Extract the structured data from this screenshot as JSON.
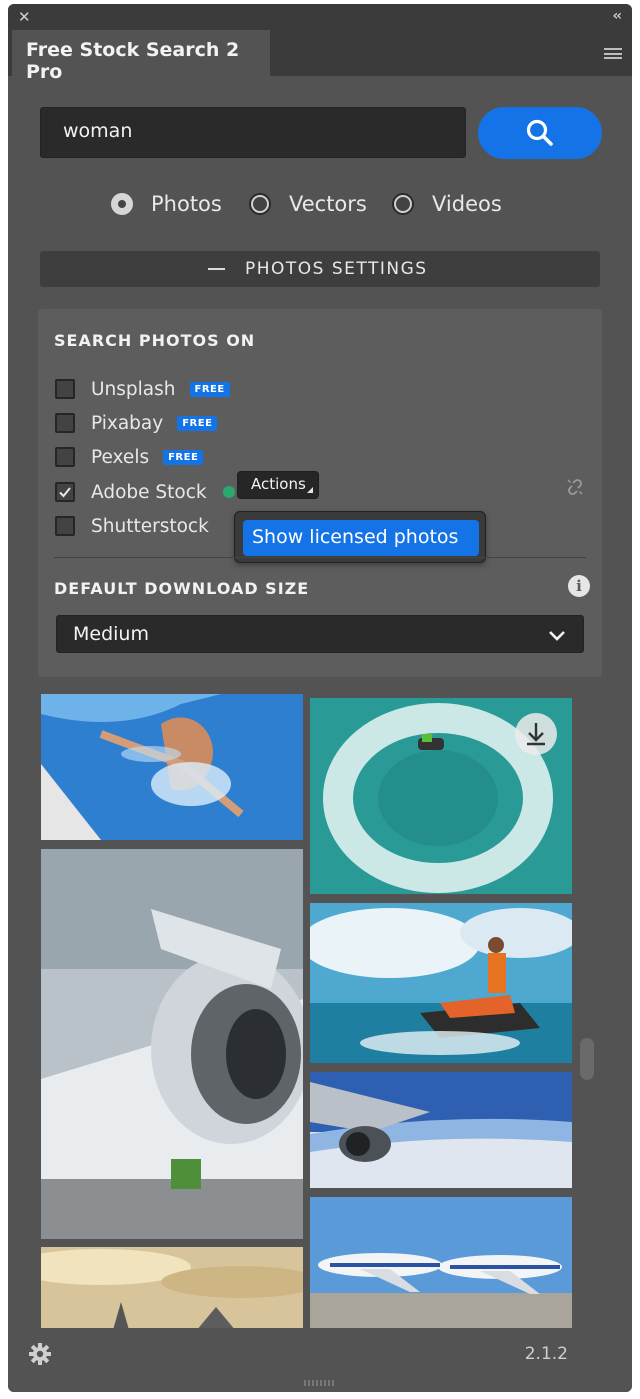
{
  "window": {
    "title": "Free Stock Search 2 Pro"
  },
  "search": {
    "value": "woman"
  },
  "media_types": [
    {
      "label": "Photos",
      "selected": true
    },
    {
      "label": "Vectors",
      "selected": false
    },
    {
      "label": "Videos",
      "selected": false
    }
  ],
  "settings_toggle": {
    "label": "PHOTOS SETTINGS",
    "expanded": true
  },
  "search_on": {
    "heading": "SEARCH PHOTOS ON",
    "sources": [
      {
        "label": "Unsplash",
        "checked": false,
        "badge": "FREE"
      },
      {
        "label": "Pixabay",
        "checked": false,
        "badge": "FREE"
      },
      {
        "label": "Pexels",
        "checked": false,
        "badge": "FREE"
      },
      {
        "label": "Adobe Stock",
        "checked": true,
        "status": "connected"
      },
      {
        "label": "Shutterstock",
        "checked": false
      }
    ],
    "actions_label": "Actions",
    "popup_item": "Show licensed photos"
  },
  "download_size": {
    "heading": "DEFAULT DOWNLOAD SIZE",
    "value": "Medium"
  },
  "results": [
    "woman in swimming pool",
    "jet ski wave circle aerial",
    "aircraft engine maintenance",
    "man riding jet ski",
    "airplane engine above earth",
    "two passenger jets on tarmac",
    "fighter jet at sunset"
  ],
  "colors": {
    "accent": "#1473e6",
    "panel": "#535353",
    "connected": "#2da86d"
  },
  "footer": {
    "version": "2.1.2"
  }
}
